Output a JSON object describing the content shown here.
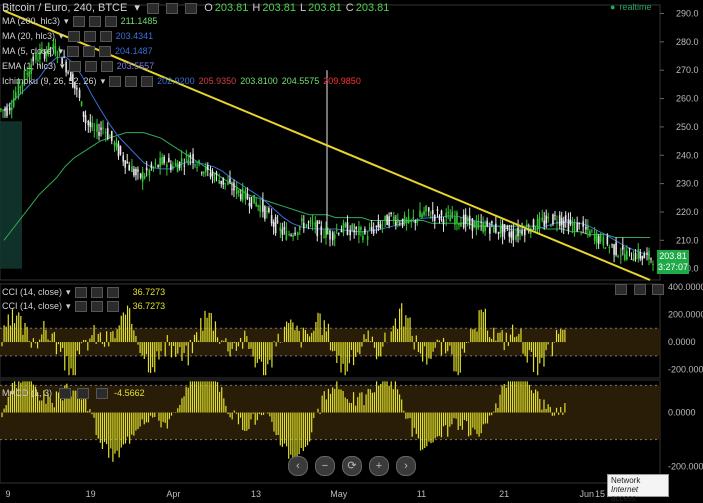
{
  "header": {
    "title": "Bitcoin / Euro, 240, BTCE",
    "ohlc": [
      {
        "label": "O",
        "value": "203.81"
      },
      {
        "label": "H",
        "value": "203.81"
      },
      {
        "label": "L",
        "value": "203.81"
      },
      {
        "label": "C",
        "value": "203.81"
      }
    ],
    "realtime": "realtime"
  },
  "indicators": [
    {
      "name": "MA (200, hlc3)",
      "values": [
        "211.1485"
      ],
      "colors": [
        "#6ee06e"
      ]
    },
    {
      "name": "MA (20, hlc3)",
      "values": [
        "203.4341"
      ],
      "colors": [
        "#3b6fd6"
      ]
    },
    {
      "name": "MA (5, close)",
      "values": [
        "204.1487"
      ],
      "colors": [
        "#3b6fd6"
      ]
    },
    {
      "name": "EMA (1, hlc3)",
      "values": [
        "203.5557"
      ],
      "colors": [
        "#7a7af0"
      ]
    },
    {
      "name": "Ichimoku (9, 26, 52, 26)",
      "values": [
        "202.9200",
        "205.9350",
        "203.8100",
        "204.5575",
        "209.9850"
      ],
      "colors": [
        "#3b6fd6",
        "#d04040",
        "#6ee06e",
        "#6ee06e",
        "#ff3030"
      ]
    }
  ],
  "cci_legend": [
    {
      "name": "CCI (14, close)",
      "value": "36.7273"
    },
    {
      "name": "CCI (14, close)",
      "value": "36.7273"
    }
  ],
  "osc_legend": {
    "name": "MACD (1, 3)",
    "value": "-4.5662"
  },
  "price_badge": {
    "price": "203.81",
    "time": "3:27:07"
  },
  "tooltip": {
    "title": "Network",
    "subtitle": "Internet access"
  },
  "nav_buttons": [
    {
      "name": "scroll-left-button",
      "glyph": "‹"
    },
    {
      "name": "zoom-out-button",
      "glyph": "−"
    },
    {
      "name": "reset-button",
      "glyph": "⟳"
    },
    {
      "name": "zoom-in-button",
      "glyph": "+"
    },
    {
      "name": "scroll-right-button",
      "glyph": "›"
    }
  ],
  "colors": {
    "candle_up": "#37c837",
    "candle_down": "#e8e8e8",
    "trend": "#e8d52a",
    "cci": "#e2e22a",
    "osc": "#e2e22a",
    "ma_green": "#2faa5a",
    "ma_blue": "#3b6fd6"
  },
  "chart_data": {
    "type": "candlestick",
    "price_axis": {
      "ticks": [
        290,
        280,
        270,
        260,
        250,
        240,
        230,
        220,
        210,
        200
      ],
      "ylim": [
        196,
        293
      ]
    },
    "x_axis_labels": [
      "9",
      "19",
      "Apr",
      "13",
      "May",
      "11",
      "21",
      "Jun",
      "15"
    ],
    "close_series": [
      256,
      262,
      268,
      274,
      276,
      278,
      276,
      270,
      262,
      252,
      248,
      250,
      245,
      240,
      236,
      232,
      234,
      236,
      238,
      236,
      238,
      240,
      236,
      234,
      232,
      230,
      228,
      226,
      224,
      222,
      218,
      214,
      212,
      214,
      216,
      215,
      213,
      212,
      214,
      214,
      213,
      212,
      214,
      216,
      218,
      217,
      216,
      218,
      220,
      219,
      218,
      218,
      217,
      216,
      215,
      215,
      214,
      213,
      212,
      214,
      215,
      216,
      217,
      218,
      216,
      215,
      214,
      212,
      210,
      208,
      206,
      205,
      205,
      204,
      204
    ],
    "ma200_series": [
      210,
      214,
      218,
      222,
      226,
      229,
      232,
      236,
      239,
      241,
      243,
      245,
      246,
      247,
      248,
      248,
      248,
      247,
      246,
      244,
      242,
      240,
      238,
      236,
      234,
      232,
      230,
      228,
      226,
      225,
      224,
      223,
      222,
      221,
      220,
      219,
      219,
      219,
      218,
      218,
      218,
      218,
      217,
      217,
      217,
      217,
      217,
      217,
      217,
      216,
      216,
      216,
      216,
      216,
      215,
      215,
      215,
      215,
      215,
      215,
      215,
      215,
      214,
      214,
      214,
      213,
      213,
      212,
      212,
      212,
      211,
      211,
      211,
      211,
      211
    ],
    "trend_line": {
      "start": [
        0,
        291
      ],
      "end": [
        74,
        196
      ]
    },
    "spike": {
      "index": 37,
      "high": 270
    },
    "cci": {
      "ticks": [
        400,
        200,
        0,
        -200
      ],
      "ylim": [
        -260,
        420
      ],
      "band": [
        -100,
        100
      ]
    },
    "osc": {
      "ticks": [
        0,
        -200
      ],
      "ylim": [
        -260,
        120
      ],
      "band": [
        -100,
        100
      ]
    }
  }
}
